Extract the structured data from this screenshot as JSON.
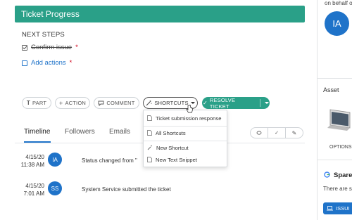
{
  "progress": {
    "title": "Ticket Progress"
  },
  "next_steps": {
    "heading": "NEXT STEPS",
    "items": [
      {
        "label": "Confirm issue",
        "required_mark": "*",
        "done": true
      },
      {
        "label": "Add actions",
        "required_mark": "*",
        "done": false
      }
    ]
  },
  "action_bar": {
    "part": "PART",
    "action": "ACTION",
    "comment": "COMMENT",
    "shortcuts": "SHORTCUTS",
    "resolve": "RESOLVE TICKET"
  },
  "shortcuts_menu": {
    "items": [
      "Ticket submission response",
      "All Shortcuts",
      "New Shortcut",
      "New Text Snippet"
    ]
  },
  "tabs": {
    "timeline": "Timeline",
    "followers": "Followers",
    "emails": "Emails"
  },
  "timeline": [
    {
      "date": "4/15/20",
      "time": "11:38 AM",
      "initials": "IA",
      "text": "Status changed from \""
    },
    {
      "date": "4/15/20",
      "time": "7:01 AM",
      "initials": "SS",
      "text": "System Service submitted the ticket"
    }
  ],
  "sidebar": {
    "behalf_text": "on behalf o",
    "avatar_initials": "IA",
    "asset_heading": "Asset",
    "options_label": "OPTIONS",
    "spare_label": "Spare A",
    "there_label": "There are s",
    "issue_button": "ISSUI"
  },
  "colors": {
    "accent_green": "#2aa088",
    "accent_blue": "#1f73c9",
    "required_red": "#d0021b"
  }
}
